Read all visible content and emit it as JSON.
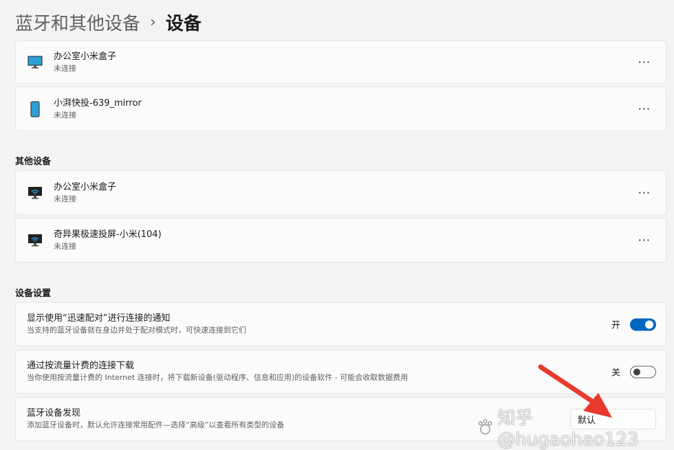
{
  "breadcrumb": {
    "parent": "蓝牙和其他设备",
    "separator": "›",
    "current": "设备"
  },
  "devices_top": [
    {
      "name": "办公室小米盒子",
      "status": "未连接",
      "icon": "monitor-icon",
      "more": "···"
    },
    {
      "name": "小湃快投-639_mirror",
      "status": "未连接",
      "icon": "phone-icon",
      "more": "···"
    }
  ],
  "other_devices": {
    "title": "其他设备",
    "items": [
      {
        "name": "办公室小米盒子",
        "status": "未连接",
        "icon": "wireless-display-icon",
        "more": "···"
      },
      {
        "name": "奇异果极速投屏-小米(104)",
        "status": "未连接",
        "icon": "wireless-display-icon",
        "more": "···"
      }
    ]
  },
  "device_settings": {
    "title": "设备设置",
    "swift_pair": {
      "title": "显示使用“迅速配对”进行连接的通知",
      "desc": "当支持的蓝牙设备就在身边并处于配对模式时，可快速连接到它们",
      "state_label": "开",
      "on": true
    },
    "metered": {
      "title": "通过按流量计费的连接下载",
      "desc": "当你使用按流量计费的 Internet 连接时，将下载新设备(驱动程序、信息和应用)的设备软件 - 可能会收取数据费用",
      "state_label": "关",
      "on": false
    },
    "discovery": {
      "title": "蓝牙设备发现",
      "desc": "添加蓝牙设备时，默认允许连接常用配件—选择“高级”以查看所有类型的设备",
      "value": "默认"
    }
  },
  "colors": {
    "accent": "#0067c0",
    "arrow": "#e83a2c"
  },
  "watermark": {
    "text": "知乎 @hugaohao123"
  }
}
